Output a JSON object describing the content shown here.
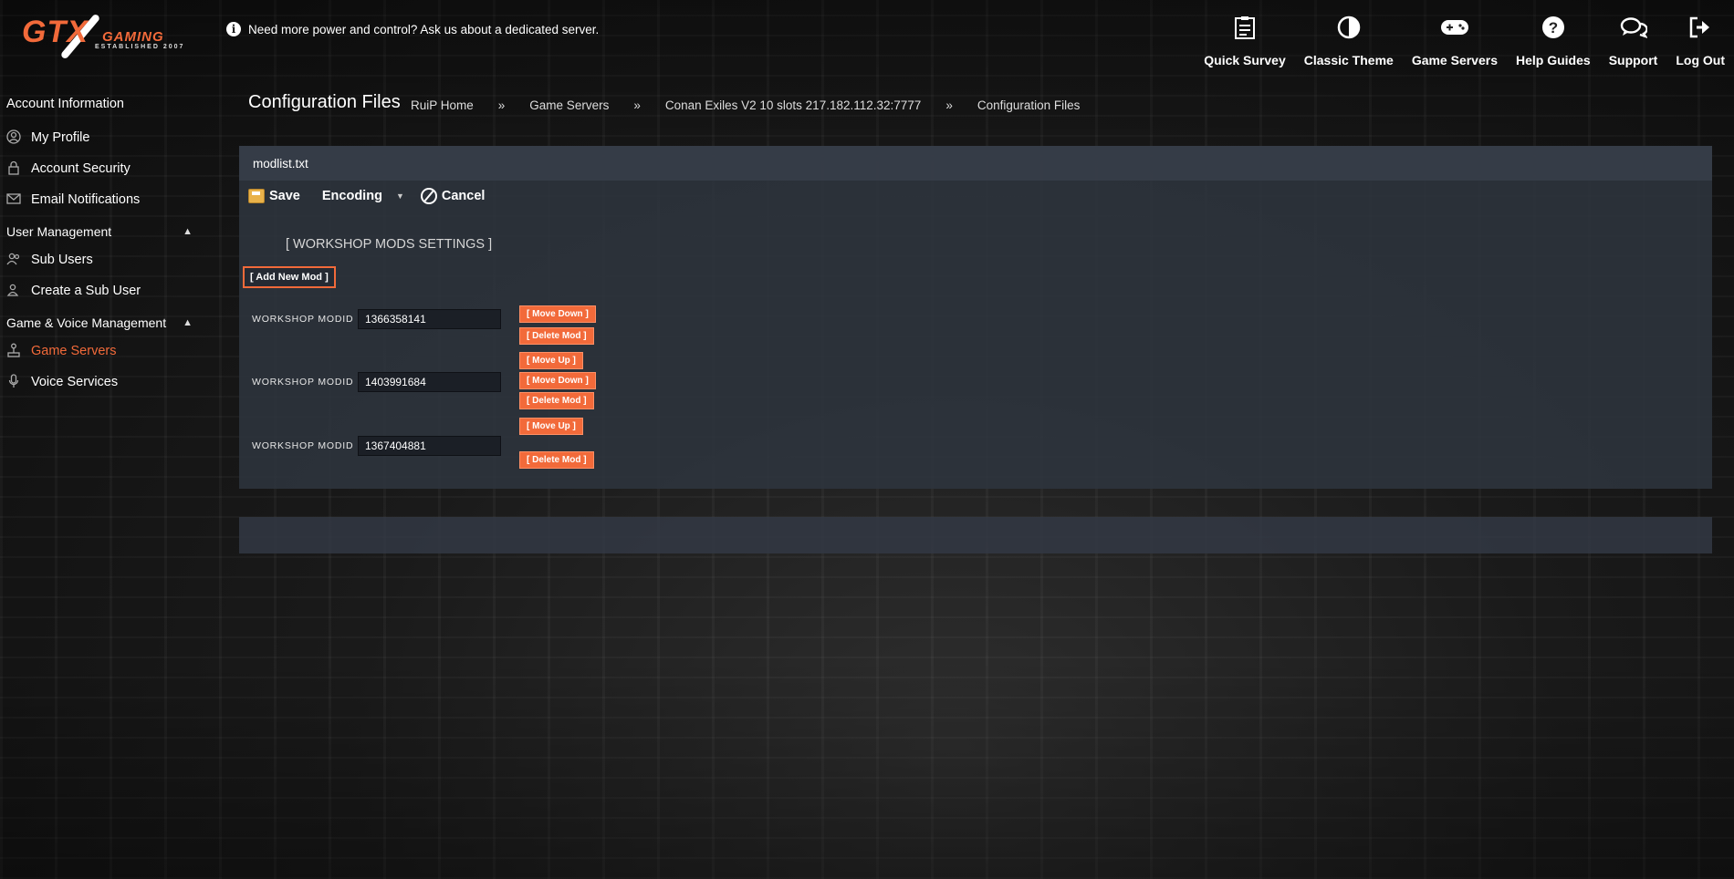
{
  "logo": {
    "main": "GTX",
    "sub": "GAMING",
    "tagline": "ESTABLISHED 2007"
  },
  "notice": {
    "text": "Need more power and control? Ask us about a dedicated server."
  },
  "topnav": [
    {
      "label": "Quick Survey",
      "icon": "clipboard-icon"
    },
    {
      "label": "Classic Theme",
      "icon": "contrast-icon"
    },
    {
      "label": "Game Servers",
      "icon": "gamepad-icon"
    },
    {
      "label": "Help Guides",
      "icon": "question-icon"
    },
    {
      "label": "Support",
      "icon": "chat-icon"
    },
    {
      "label": "Log Out",
      "icon": "logout-icon"
    }
  ],
  "sidebar": {
    "account_heading": "Account Information",
    "account_items": [
      {
        "label": "My Profile",
        "icon": "profile-icon"
      },
      {
        "label": "Account Security",
        "icon": "lock-icon"
      },
      {
        "label": "Email Notifications",
        "icon": "envelope-icon"
      }
    ],
    "user_heading": "User Management",
    "user_items": [
      {
        "label": "Sub Users",
        "icon": "users-icon"
      },
      {
        "label": "Create a Sub User",
        "icon": "add-user-icon"
      }
    ],
    "game_heading": "Game & Voice Management",
    "game_items": [
      {
        "label": "Game Servers",
        "icon": "joystick-icon",
        "active": true
      },
      {
        "label": "Voice Services",
        "icon": "microphone-icon"
      }
    ]
  },
  "page": {
    "title": "Configuration Files",
    "breadcrumb": [
      "RuiP Home",
      "Game Servers",
      "Conan Exiles V2 10 slots 217.182.112.32:7777",
      "Configuration Files"
    ],
    "breadcrumb_sep": "»"
  },
  "editor": {
    "filename": "modlist.txt",
    "toolbar": {
      "save": "Save",
      "encoding": "Encoding",
      "cancel": "Cancel"
    },
    "section_title": "[ WORKSHOP MODS SETTINGS ]",
    "add_button": "[ Add New Mod ]",
    "field_label": "WORKSHOP MODID",
    "mods": [
      {
        "id": "1366358141"
      },
      {
        "id": "1403991684"
      },
      {
        "id": "1367404881"
      }
    ],
    "btn_move_up": "[ Move Up ]",
    "btn_move_down": "[ Move Down ]",
    "btn_delete": "[ Delete Mod ]"
  },
  "colors": {
    "accent": "#f26a3a",
    "panel": "#2e343e"
  }
}
